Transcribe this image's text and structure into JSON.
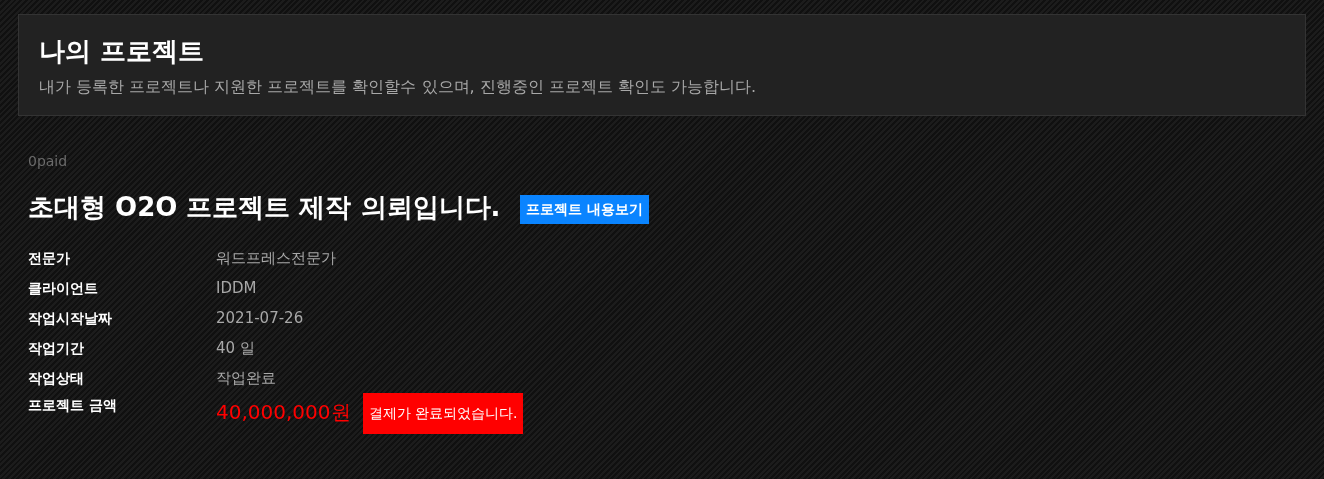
{
  "header": {
    "title": "나의 프로젝트",
    "description": "내가 등록한 프로젝트나 지원한 프로젝트를 확인할수 있으며, 진행중인 프로젝트 확인도 가능합니다."
  },
  "project": {
    "status_code": "0paid",
    "title": "초대형 O2O 프로젝트 제작 의뢰입니다.",
    "view_button": "프로젝트 내용보기",
    "details": [
      {
        "label": "전문가",
        "value": "워드프레스전문가"
      },
      {
        "label": "클라이언트",
        "value": "IDDM"
      },
      {
        "label": "작업시작날짜",
        "value": "2021-07-26"
      },
      {
        "label": "작업기간",
        "value": "40 일"
      },
      {
        "label": "작업상태",
        "value": "작업완료"
      }
    ],
    "amount": {
      "label": "프로젝트 금액",
      "value": "40,000,000원",
      "payment_notice": "결제가 완료되었습니다."
    }
  }
}
